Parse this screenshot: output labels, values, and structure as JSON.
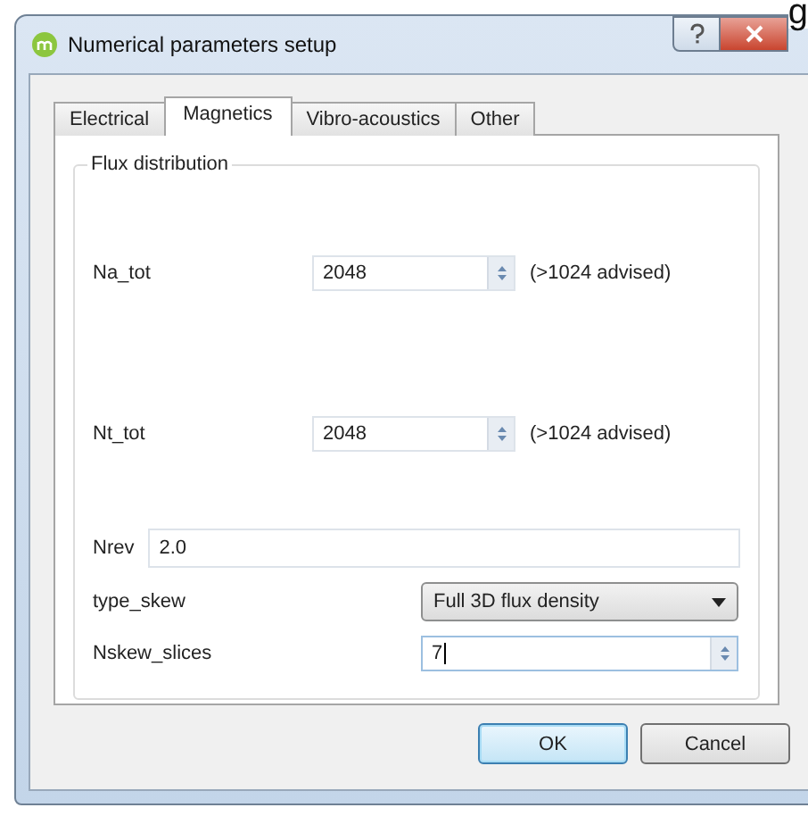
{
  "background_text": "g",
  "window": {
    "title": "Numerical parameters setup"
  },
  "tabs": [
    {
      "label": "Electrical",
      "selected": false
    },
    {
      "label": "Magnetics",
      "selected": true
    },
    {
      "label": "Vibro-acoustics",
      "selected": false
    },
    {
      "label": "Other",
      "selected": false
    }
  ],
  "group": {
    "title": "Flux distribution",
    "fields": [
      {
        "kind": "spin",
        "label": "Na_tot",
        "value": "2048",
        "note": "(>1024 advised)"
      },
      {
        "kind": "spin",
        "label": "Nt_tot",
        "value": "2048",
        "note": "(>1024 advised)"
      },
      {
        "kind": "text",
        "label": "Nrev",
        "value": "2.0"
      },
      {
        "kind": "combo",
        "label": "type_skew",
        "value": "Full 3D flux density"
      },
      {
        "kind": "widespin",
        "label": "Nskew_slices",
        "value": "7",
        "focused": true
      }
    ]
  },
  "buttons": [
    {
      "label": "OK",
      "default": true
    },
    {
      "label": "Cancel",
      "default": false
    }
  ]
}
